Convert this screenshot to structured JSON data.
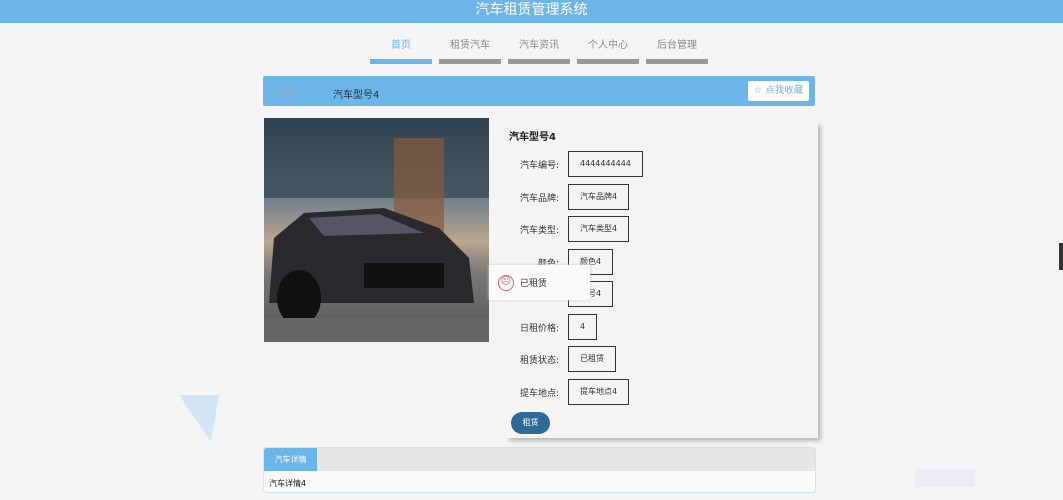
{
  "header": {
    "title": "汽车租赁管理系统"
  },
  "nav": {
    "items": [
      {
        "label": "首页",
        "active": true
      },
      {
        "label": "租赁汽车"
      },
      {
        "label": "汽车资讯"
      },
      {
        "label": "个人中心"
      },
      {
        "label": "后台管理"
      }
    ]
  },
  "breadcrumb": {
    "home": "首页",
    "separator": "/",
    "current": "汽车型号4",
    "favorite_label": "☆ 点我收藏"
  },
  "detail": {
    "title": "汽车型号4",
    "fields": [
      {
        "label": "汽车编号:",
        "value": "4444444444"
      },
      {
        "label": "汽车品牌:",
        "value": "汽车品牌4"
      },
      {
        "label": "汽车类型:",
        "value": "汽车类型4"
      },
      {
        "label": "颜色:",
        "value": "颜色4"
      },
      {
        "label": "",
        "value": "牌号4"
      },
      {
        "label": "日租价格:",
        "value": "4"
      },
      {
        "label": "租赁状态:",
        "value": "已租赁"
      },
      {
        "label": "提车地点:",
        "value": "提车地点4"
      }
    ],
    "rent_button": "租赁"
  },
  "toast": {
    "message": "已租赁",
    "icon": "sad-face-icon",
    "color": "#e06060"
  },
  "tabs": {
    "active": "汽车详情",
    "content": "汽车详情4"
  },
  "colors": {
    "primary": "#6bb5e8",
    "button": "#2f6b96"
  }
}
